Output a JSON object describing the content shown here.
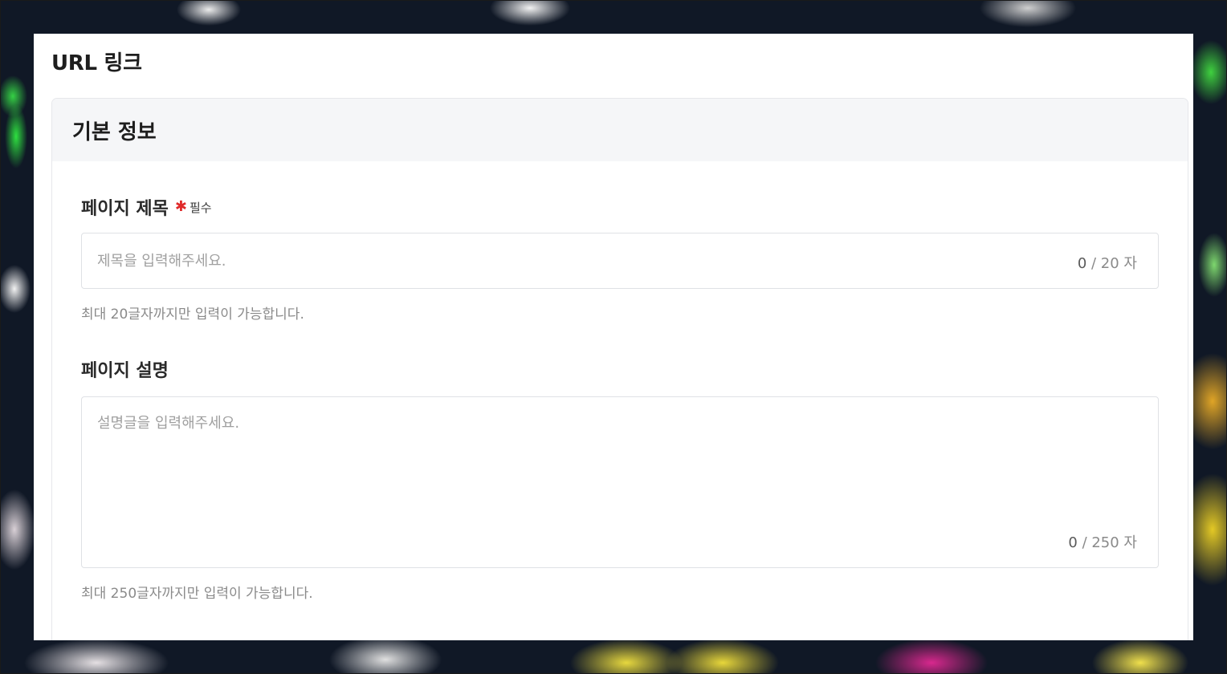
{
  "page": {
    "title": "URL 링크"
  },
  "section": {
    "title": "기본 정보"
  },
  "title_field": {
    "label": "페이지 제목",
    "required_mark": "✱",
    "required_text": "필수",
    "placeholder": "제목을 입력해주세요.",
    "count_current": "0",
    "count_rest": " / 20 자",
    "helper": "최대 20글자까지만 입력이 가능합니다."
  },
  "description_field": {
    "label": "페이지 설명",
    "placeholder": "설명글을 입력해주세요.",
    "count_current": "0",
    "count_rest": " / 250 자",
    "helper": "최대 250글자까지만 입력이 가능합니다."
  },
  "colors": {
    "required": "#e02a2a",
    "header_bg": "#f5f6f8",
    "border": "#dfe1e5",
    "placeholder": "#a0a0a0"
  }
}
